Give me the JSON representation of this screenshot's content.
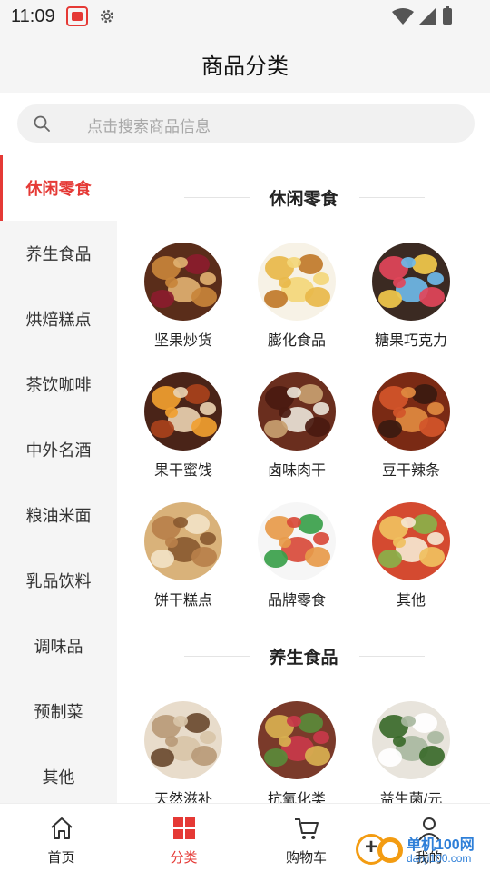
{
  "status_bar": {
    "time": "11:09"
  },
  "header": {
    "title": "商品分类"
  },
  "search": {
    "placeholder": "点击搜索商品信息"
  },
  "sidebar": {
    "active_index": 0,
    "items": [
      {
        "label": "休闲零食"
      },
      {
        "label": "养生食品"
      },
      {
        "label": "烘焙糕点"
      },
      {
        "label": "茶饮咖啡"
      },
      {
        "label": "中外名酒"
      },
      {
        "label": "粮油米面"
      },
      {
        "label": "乳品饮料"
      },
      {
        "label": "调味品"
      },
      {
        "label": "预制菜"
      },
      {
        "label": "其他"
      }
    ]
  },
  "sections": [
    {
      "title": "休闲零食",
      "items": [
        {
          "label": "坚果炒货",
          "colors": [
            "#5a2d1a",
            "#c8843a",
            "#8b1c2c",
            "#e0b070"
          ]
        },
        {
          "label": "膨化食品",
          "colors": [
            "#f7f2e6",
            "#e8b84a",
            "#c07a2a",
            "#f3d77a"
          ]
        },
        {
          "label": "糖果巧克力",
          "colors": [
            "#3b2a22",
            "#e2455a",
            "#f2c94c",
            "#6fb8e8"
          ]
        },
        {
          "label": "果干蜜饯",
          "colors": [
            "#4a2418",
            "#f0a030",
            "#a8421c",
            "#e8d0b0"
          ]
        },
        {
          "label": "卤味肉干",
          "colors": [
            "#6a2e1e",
            "#4a1a10",
            "#c8a070",
            "#e9e2d6"
          ]
        },
        {
          "label": "豆干辣条",
          "colors": [
            "#7a2a14",
            "#d2552a",
            "#3a1a10",
            "#e08a40"
          ]
        },
        {
          "label": "饼干糕点",
          "colors": [
            "#d9b27a",
            "#b8804a",
            "#f2e2c4",
            "#8a5a30"
          ]
        },
        {
          "label": "品牌零食",
          "colors": [
            "#f6f6f6",
            "#e79a4a",
            "#3aa04a",
            "#d84a3a"
          ]
        },
        {
          "label": "其他",
          "colors": [
            "#d44a30",
            "#f0c060",
            "#8ab04a",
            "#f5e6d0"
          ]
        }
      ]
    },
    {
      "title": "养生食品",
      "items": [
        {
          "label": "天然滋补",
          "colors": [
            "#e8dccb",
            "#b89a78",
            "#6a4a30",
            "#d8c4a8"
          ]
        },
        {
          "label": "抗氧化类",
          "colors": [
            "#7a3a2a",
            "#d8b050",
            "#5a8a3a",
            "#c83a4a"
          ]
        },
        {
          "label": "益生菌/元",
          "colors": [
            "#e8e4dc",
            "#3a6a2a",
            "#ffffff",
            "#a8b8a0"
          ]
        }
      ]
    }
  ],
  "tabbar": {
    "active_index": 1,
    "items": [
      {
        "label": "首页",
        "icon": "home-icon"
      },
      {
        "label": "分类",
        "icon": "category-icon"
      },
      {
        "label": "购物车",
        "icon": "cart-icon"
      },
      {
        "label": "我的",
        "icon": "profile-icon"
      }
    ]
  },
  "watermark": {
    "name": "单机100网",
    "url": "danji100.com"
  },
  "theme": {
    "accent": "#e53935",
    "sidebar_bg": "#f5f5f5",
    "search_bg": "#f1f1f1"
  }
}
